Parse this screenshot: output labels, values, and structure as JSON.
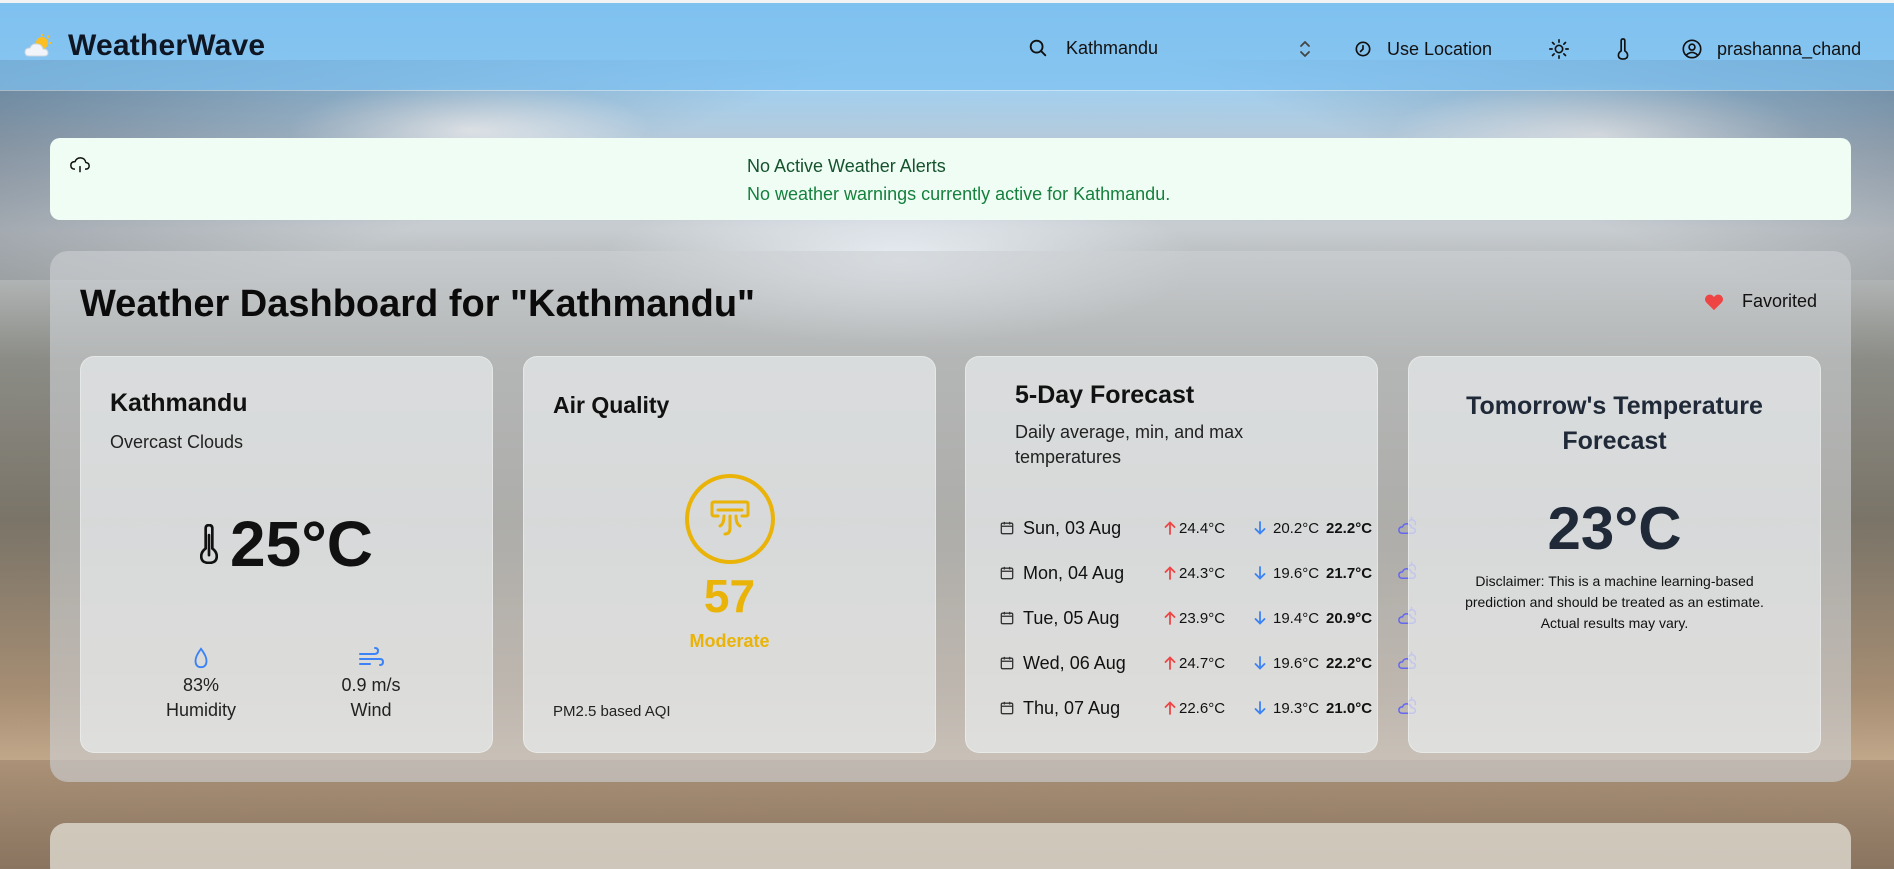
{
  "app": {
    "brand": "WeatherWave",
    "search": {
      "value": "Kathmandu",
      "placeholder": "Search city"
    },
    "use_location": "Use Location",
    "username": "prashanna_chand"
  },
  "alert": {
    "title": "No Active Weather Alerts",
    "message": "No weather warnings currently active for Kathmandu."
  },
  "dashboard": {
    "title": "Weather Dashboard for \"Kathmandu\"",
    "favorite_label": "Favorited",
    "current": {
      "city": "Kathmandu",
      "description": "Overcast Clouds",
      "temperature": "25°C",
      "humidity_value": "83%",
      "humidity_label": "Humidity",
      "wind_value": "0.9 m/s",
      "wind_label": "Wind"
    },
    "air_quality": {
      "title": "Air Quality",
      "value": "57",
      "level": "Moderate",
      "footer": "PM2.5 based AQI"
    },
    "forecast": {
      "title": "5-Day Forecast",
      "subtitle": "Daily average, min, and max temperatures",
      "days": [
        {
          "day": "Sun, 03 Aug",
          "max": "24.4°C",
          "min": "20.2°C",
          "avg": "22.2°C"
        },
        {
          "day": "Mon, 04 Aug",
          "max": "24.3°C",
          "min": "19.6°C",
          "avg": "21.7°C"
        },
        {
          "day": "Tue, 05 Aug",
          "max": "23.9°C",
          "min": "19.4°C",
          "avg": "20.9°C"
        },
        {
          "day": "Wed, 06 Aug",
          "max": "24.7°C",
          "min": "19.6°C",
          "avg": "22.2°C"
        },
        {
          "day": "Thu, 07 Aug",
          "max": "22.6°C",
          "min": "19.3°C",
          "avg": "21.0°C"
        }
      ]
    },
    "tomorrow": {
      "title": "Tomorrow's Temperature Forecast",
      "temperature": "23°C",
      "disclaimer": "Disclaimer: This is a machine learning-based prediction and should be treated as an estimate. Actual results may vary."
    }
  },
  "colors": {
    "aqi_moderate": "#eab308",
    "alert_bg": "#f0fdf4",
    "alert_title": "#14532d",
    "alert_text": "#15803d",
    "favorite_heart": "#ef4444",
    "arrow_up": "#ef4444",
    "arrow_down": "#3b82f6",
    "accent_blue": "#3b82f6"
  },
  "icons": {
    "brand": "sun-cloud-icon",
    "search": "search-icon",
    "select": "chevron-up-down-icon",
    "location": "location-icon",
    "theme": "sun-icon",
    "unit": "thermometer-icon",
    "user": "user-circle-icon",
    "alert": "cloud-icon",
    "favorite": "heart-icon",
    "temp": "thermometer-icon",
    "humidity": "droplet-icon",
    "wind": "wind-icon",
    "aqi": "air-vent-icon",
    "calendar": "calendar-icon",
    "forecast_weather": "cloud-sun-icon"
  }
}
